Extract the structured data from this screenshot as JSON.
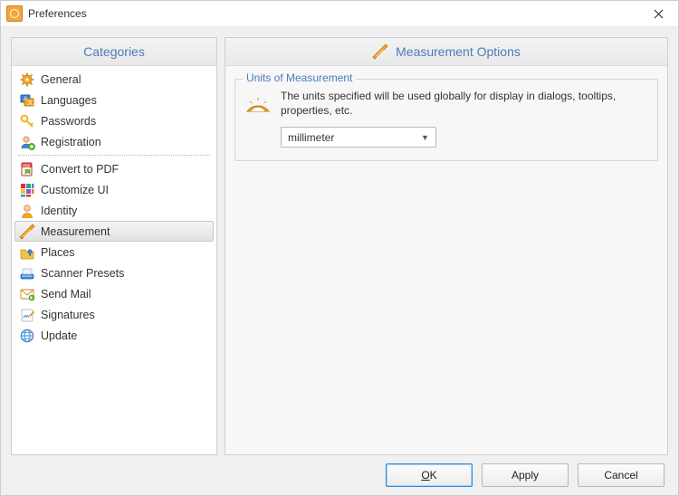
{
  "window": {
    "title": "Preferences"
  },
  "sidebar": {
    "header": "Categories",
    "group1": [
      {
        "label": "General",
        "icon": "gear"
      },
      {
        "label": "Languages",
        "icon": "languages"
      },
      {
        "label": "Passwords",
        "icon": "key"
      },
      {
        "label": "Registration",
        "icon": "user-add"
      }
    ],
    "group2": [
      {
        "label": "Convert to PDF",
        "icon": "pdf"
      },
      {
        "label": "Customize UI",
        "icon": "grid"
      },
      {
        "label": "Identity",
        "icon": "identity"
      },
      {
        "label": "Measurement",
        "icon": "ruler",
        "selected": true
      },
      {
        "label": "Places",
        "icon": "folder-pin"
      },
      {
        "label": "Scanner Presets",
        "icon": "scanner"
      },
      {
        "label": "Send Mail",
        "icon": "mail"
      },
      {
        "label": "Signatures",
        "icon": "signature"
      },
      {
        "label": "Update",
        "icon": "globe"
      }
    ]
  },
  "main": {
    "header": "Measurement Options",
    "group": {
      "title": "Units of Measurement",
      "description": "The units specified will be used globally for display in dialogs, tooltips, properties, etc.",
      "unit_value": "millimeter"
    }
  },
  "footer": {
    "ok": "OK",
    "apply": "Apply",
    "cancel": "Cancel"
  }
}
